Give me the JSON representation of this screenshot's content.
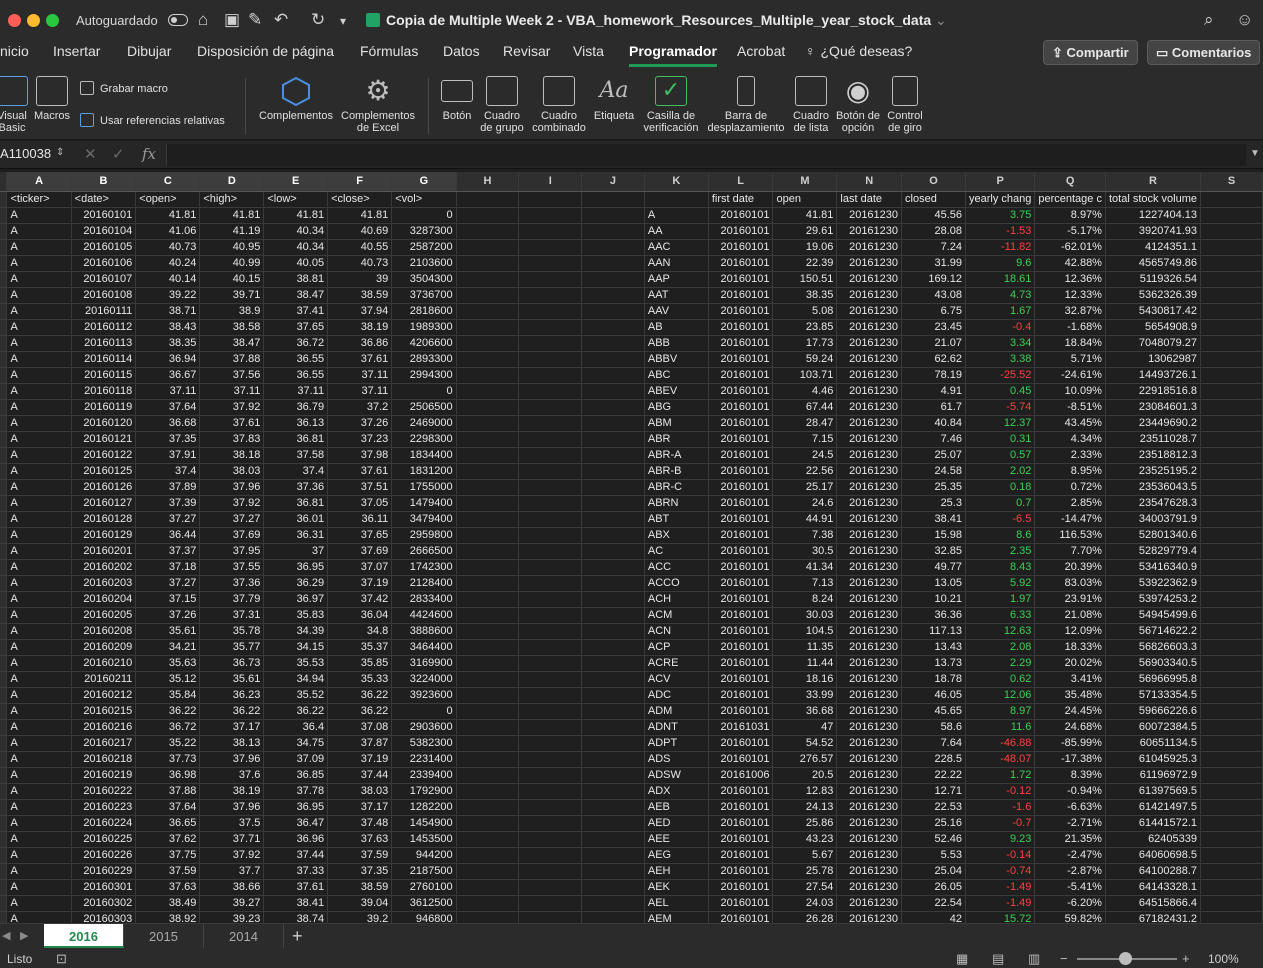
{
  "titlebar": {
    "autosave_label": "Autoguardado",
    "doc_title": "Copia de Multiple Week 2 - VBA_homework_Resources_Multiple_year_stock_data"
  },
  "menu": {
    "tabs": [
      "nicio",
      "Insertar",
      "Dibujar",
      "Disposición de página",
      "Fórmulas",
      "Datos",
      "Revisar",
      "Vista",
      "Programador",
      "Acrobat",
      "¿Qué deseas?"
    ],
    "active": "Programador",
    "share": "Compartir",
    "comments": "Comentarios"
  },
  "ribbon": {
    "visual_basic": "Visual Basic",
    "macros": "Macros",
    "record_macro": "Grabar macro",
    "relative_refs": "Usar referencias relativas",
    "addins": "Complementos",
    "excel_addins": "Complementos de Excel",
    "button": "Botón",
    "group_box": "Cuadro de grupo",
    "combo_box": "Cuadro combinado",
    "label": "Etiqueta",
    "checkbox": "Casilla de verificación",
    "scrollbar": "Barra de desplazamiento",
    "list_box": "Cuadro de lista",
    "option_button": "Botón de opción",
    "spin_button": "Control de giro"
  },
  "formula_bar": {
    "name_box": "A110038",
    "fx": "fx",
    "value": ""
  },
  "columns": [
    "A",
    "B",
    "C",
    "D",
    "E",
    "F",
    "G",
    "H",
    "I",
    "J",
    "K",
    "L",
    "M",
    "N",
    "O",
    "P",
    "Q",
    "R",
    "S"
  ],
  "selected_columns": [
    "A",
    "B",
    "C",
    "D",
    "E",
    "F",
    "G"
  ],
  "left_headers": [
    "<ticker>",
    "<date>",
    "<open>",
    "<high>",
    "<low>",
    "<close>",
    "<vol>"
  ],
  "right_headers": [
    "first date",
    "open",
    "last date",
    "closed",
    "yearly chang",
    "percentage c",
    "total stock volume"
  ],
  "left_rows": [
    [
      "A",
      "20160101",
      "41.81",
      "41.81",
      "41.81",
      "41.81",
      "0"
    ],
    [
      "A",
      "20160104",
      "41.06",
      "41.19",
      "40.34",
      "40.69",
      "3287300"
    ],
    [
      "A",
      "20160105",
      "40.73",
      "40.95",
      "40.34",
      "40.55",
      "2587200"
    ],
    [
      "A",
      "20160106",
      "40.24",
      "40.99",
      "40.05",
      "40.73",
      "2103600"
    ],
    [
      "A",
      "20160107",
      "40.14",
      "40.15",
      "38.81",
      "39",
      "3504300"
    ],
    [
      "A",
      "20160108",
      "39.22",
      "39.71",
      "38.47",
      "38.59",
      "3736700"
    ],
    [
      "A",
      "20160111",
      "38.71",
      "38.9",
      "37.41",
      "37.94",
      "2818600"
    ],
    [
      "A",
      "20160112",
      "38.43",
      "38.58",
      "37.65",
      "38.19",
      "1989300"
    ],
    [
      "A",
      "20160113",
      "38.35",
      "38.47",
      "36.72",
      "36.86",
      "4206600"
    ],
    [
      "A",
      "20160114",
      "36.94",
      "37.88",
      "36.55",
      "37.61",
      "2893300"
    ],
    [
      "A",
      "20160115",
      "36.67",
      "37.56",
      "36.55",
      "37.11",
      "2994300"
    ],
    [
      "A",
      "20160118",
      "37.11",
      "37.11",
      "37.11",
      "37.11",
      "0"
    ],
    [
      "A",
      "20160119",
      "37.64",
      "37.92",
      "36.79",
      "37.2",
      "2506500"
    ],
    [
      "A",
      "20160120",
      "36.68",
      "37.61",
      "36.13",
      "37.26",
      "2469000"
    ],
    [
      "A",
      "20160121",
      "37.35",
      "37.83",
      "36.81",
      "37.23",
      "2298300"
    ],
    [
      "A",
      "20160122",
      "37.91",
      "38.18",
      "37.58",
      "37.98",
      "1834400"
    ],
    [
      "A",
      "20160125",
      "37.4",
      "38.03",
      "37.4",
      "37.61",
      "1831200"
    ],
    [
      "A",
      "20160126",
      "37.89",
      "37.96",
      "37.36",
      "37.51",
      "1755000"
    ],
    [
      "A",
      "20160127",
      "37.39",
      "37.92",
      "36.81",
      "37.05",
      "1479400"
    ],
    [
      "A",
      "20160128",
      "37.27",
      "37.27",
      "36.01",
      "36.11",
      "3479400"
    ],
    [
      "A",
      "20160129",
      "36.44",
      "37.69",
      "36.31",
      "37.65",
      "2959800"
    ],
    [
      "A",
      "20160201",
      "37.37",
      "37.95",
      "37",
      "37.69",
      "2666500"
    ],
    [
      "A",
      "20160202",
      "37.18",
      "37.55",
      "36.95",
      "37.07",
      "1742300"
    ],
    [
      "A",
      "20160203",
      "37.27",
      "37.36",
      "36.29",
      "37.19",
      "2128400"
    ],
    [
      "A",
      "20160204",
      "37.15",
      "37.79",
      "36.97",
      "37.42",
      "2833400"
    ],
    [
      "A",
      "20160205",
      "37.26",
      "37.31",
      "35.83",
      "36.04",
      "4424600"
    ],
    [
      "A",
      "20160208",
      "35.61",
      "35.78",
      "34.39",
      "34.8",
      "3888600"
    ],
    [
      "A",
      "20160209",
      "34.21",
      "35.77",
      "34.15",
      "35.37",
      "3464400"
    ],
    [
      "A",
      "20160210",
      "35.63",
      "36.73",
      "35.53",
      "35.85",
      "3169900"
    ],
    [
      "A",
      "20160211",
      "35.12",
      "35.61",
      "34.94",
      "35.33",
      "3224000"
    ],
    [
      "A",
      "20160212",
      "35.84",
      "36.23",
      "35.52",
      "36.22",
      "3923600"
    ],
    [
      "A",
      "20160215",
      "36.22",
      "36.22",
      "36.22",
      "36.22",
      "0"
    ],
    [
      "A",
      "20160216",
      "36.72",
      "37.17",
      "36.4",
      "37.08",
      "2903600"
    ],
    [
      "A",
      "20160217",
      "35.22",
      "38.13",
      "34.75",
      "37.87",
      "5382300"
    ],
    [
      "A",
      "20160218",
      "37.73",
      "37.96",
      "37.09",
      "37.19",
      "2231400"
    ],
    [
      "A",
      "20160219",
      "36.98",
      "37.6",
      "36.85",
      "37.44",
      "2339400"
    ],
    [
      "A",
      "20160222",
      "37.88",
      "38.19",
      "37.78",
      "38.03",
      "1792900"
    ],
    [
      "A",
      "20160223",
      "37.64",
      "37.96",
      "36.95",
      "37.17",
      "1282200"
    ],
    [
      "A",
      "20160224",
      "36.65",
      "37.5",
      "36.47",
      "37.48",
      "1454900"
    ],
    [
      "A",
      "20160225",
      "37.62",
      "37.71",
      "36.96",
      "37.63",
      "1453500"
    ],
    [
      "A",
      "20160226",
      "37.75",
      "37.92",
      "37.44",
      "37.59",
      "944200"
    ],
    [
      "A",
      "20160229",
      "37.59",
      "37.7",
      "37.33",
      "37.35",
      "2187500"
    ],
    [
      "A",
      "20160301",
      "37.63",
      "38.66",
      "37.61",
      "38.59",
      "2760100"
    ],
    [
      "A",
      "20160302",
      "38.49",
      "39.27",
      "38.41",
      "39.04",
      "3612500"
    ],
    [
      "A",
      "20160303",
      "38.92",
      "39.23",
      "38.74",
      "39.2",
      "946800"
    ]
  ],
  "right_rows": [
    [
      "A",
      "20160101",
      "41.81",
      "20161230",
      "45.56",
      "3.75",
      "8.97%",
      "1227404.13"
    ],
    [
      "AA",
      "20160101",
      "29.61",
      "20161230",
      "28.08",
      "-1.53",
      "-5.17%",
      "3920741.93"
    ],
    [
      "AAC",
      "20160101",
      "19.06",
      "20161230",
      "7.24",
      "-11.82",
      "-62.01%",
      "4124351.1"
    ],
    [
      "AAN",
      "20160101",
      "22.39",
      "20161230",
      "31.99",
      "9.6",
      "42.88%",
      "4565749.86"
    ],
    [
      "AAP",
      "20160101",
      "150.51",
      "20161230",
      "169.12",
      "18.61",
      "12.36%",
      "5119326.54"
    ],
    [
      "AAT",
      "20160101",
      "38.35",
      "20161230",
      "43.08",
      "4.73",
      "12.33%",
      "5362326.39"
    ],
    [
      "AAV",
      "20160101",
      "5.08",
      "20161230",
      "6.75",
      "1.67",
      "32.87%",
      "5430817.42"
    ],
    [
      "AB",
      "20160101",
      "23.85",
      "20161230",
      "23.45",
      "-0.4",
      "-1.68%",
      "5654908.9"
    ],
    [
      "ABB",
      "20160101",
      "17.73",
      "20161230",
      "21.07",
      "3.34",
      "18.84%",
      "7048079.27"
    ],
    [
      "ABBV",
      "20160101",
      "59.24",
      "20161230",
      "62.62",
      "3.38",
      "5.71%",
      "13062987"
    ],
    [
      "ABC",
      "20160101",
      "103.71",
      "20161230",
      "78.19",
      "-25.52",
      "-24.61%",
      "14493726.1"
    ],
    [
      "ABEV",
      "20160101",
      "4.46",
      "20161230",
      "4.91",
      "0.45",
      "10.09%",
      "22918516.8"
    ],
    [
      "ABG",
      "20160101",
      "67.44",
      "20161230",
      "61.7",
      "-5.74",
      "-8.51%",
      "23084601.3"
    ],
    [
      "ABM",
      "20160101",
      "28.47",
      "20161230",
      "40.84",
      "12.37",
      "43.45%",
      "23449690.2"
    ],
    [
      "ABR",
      "20160101",
      "7.15",
      "20161230",
      "7.46",
      "0.31",
      "4.34%",
      "23511028.7"
    ],
    [
      "ABR-A",
      "20160101",
      "24.5",
      "20161230",
      "25.07",
      "0.57",
      "2.33%",
      "23518812.3"
    ],
    [
      "ABR-B",
      "20160101",
      "22.56",
      "20161230",
      "24.58",
      "2.02",
      "8.95%",
      "23525195.2"
    ],
    [
      "ABR-C",
      "20160101",
      "25.17",
      "20161230",
      "25.35",
      "0.18",
      "0.72%",
      "23536043.5"
    ],
    [
      "ABRN",
      "20160101",
      "24.6",
      "20161230",
      "25.3",
      "0.7",
      "2.85%",
      "23547628.3"
    ],
    [
      "ABT",
      "20160101",
      "44.91",
      "20161230",
      "38.41",
      "-6.5",
      "-14.47%",
      "34003791.9"
    ],
    [
      "ABX",
      "20160101",
      "7.38",
      "20161230",
      "15.98",
      "8.6",
      "116.53%",
      "52801340.6"
    ],
    [
      "AC",
      "20160101",
      "30.5",
      "20161230",
      "32.85",
      "2.35",
      "7.70%",
      "52829779.4"
    ],
    [
      "ACC",
      "20160101",
      "41.34",
      "20161230",
      "49.77",
      "8.43",
      "20.39%",
      "53416340.9"
    ],
    [
      "ACCO",
      "20160101",
      "7.13",
      "20161230",
      "13.05",
      "5.92",
      "83.03%",
      "53922362.9"
    ],
    [
      "ACH",
      "20160101",
      "8.24",
      "20161230",
      "10.21",
      "1.97",
      "23.91%",
      "53974253.2"
    ],
    [
      "ACM",
      "20160101",
      "30.03",
      "20161230",
      "36.36",
      "6.33",
      "21.08%",
      "54945499.6"
    ],
    [
      "ACN",
      "20160101",
      "104.5",
      "20161230",
      "117.13",
      "12.63",
      "12.09%",
      "56714622.2"
    ],
    [
      "ACP",
      "20160101",
      "11.35",
      "20161230",
      "13.43",
      "2.08",
      "18.33%",
      "56826603.3"
    ],
    [
      "ACRE",
      "20160101",
      "11.44",
      "20161230",
      "13.73",
      "2.29",
      "20.02%",
      "56903340.5"
    ],
    [
      "ACV",
      "20160101",
      "18.16",
      "20161230",
      "18.78",
      "0.62",
      "3.41%",
      "56966995.8"
    ],
    [
      "ADC",
      "20160101",
      "33.99",
      "20161230",
      "46.05",
      "12.06",
      "35.48%",
      "57133354.5"
    ],
    [
      "ADM",
      "20160101",
      "36.68",
      "20161230",
      "45.65",
      "8.97",
      "24.45%",
      "59666226.6"
    ],
    [
      "ADNT",
      "20161031",
      "47",
      "20161230",
      "58.6",
      "11.6",
      "24.68%",
      "60072384.5"
    ],
    [
      "ADPT",
      "20160101",
      "54.52",
      "20161230",
      "7.64",
      "-46.88",
      "-85.99%",
      "60651134.5"
    ],
    [
      "ADS",
      "20160101",
      "276.57",
      "20161230",
      "228.5",
      "-48.07",
      "-17.38%",
      "61045925.3"
    ],
    [
      "ADSW",
      "20161006",
      "20.5",
      "20161230",
      "22.22",
      "1.72",
      "8.39%",
      "61196972.9"
    ],
    [
      "ADX",
      "20160101",
      "12.83",
      "20161230",
      "12.71",
      "-0.12",
      "-0.94%",
      "61397569.5"
    ],
    [
      "AEB",
      "20160101",
      "24.13",
      "20161230",
      "22.53",
      "-1.6",
      "-6.63%",
      "61421497.5"
    ],
    [
      "AED",
      "20160101",
      "25.86",
      "20161230",
      "25.16",
      "-0.7",
      "-2.71%",
      "61441572.1"
    ],
    [
      "AEE",
      "20160101",
      "43.23",
      "20161230",
      "52.46",
      "9.23",
      "21.35%",
      "62405339"
    ],
    [
      "AEG",
      "20160101",
      "5.67",
      "20161230",
      "5.53",
      "-0.14",
      "-2.47%",
      "64060698.5"
    ],
    [
      "AEH",
      "20160101",
      "25.78",
      "20161230",
      "25.04",
      "-0.74",
      "-2.87%",
      "64100288.7"
    ],
    [
      "AEK",
      "20160101",
      "27.54",
      "20161230",
      "26.05",
      "-1.49",
      "-5.41%",
      "64143328.1"
    ],
    [
      "AEL",
      "20160101",
      "24.03",
      "20161230",
      "22.54",
      "-1.49",
      "-6.20%",
      "64515866.4"
    ],
    [
      "AEM",
      "20160101",
      "26.28",
      "20161230",
      "42",
      "15.72",
      "59.82%",
      "67182431.2"
    ]
  ],
  "sheets": [
    "2016",
    "2015",
    "2014"
  ],
  "active_sheet": "2016",
  "status": {
    "text": "Listo",
    "zoom": "100%",
    "zoom_level_percent": 100
  },
  "colors": {
    "positive": "#39d353",
    "negative": "#ff4040",
    "accent": "#1f9a55"
  }
}
